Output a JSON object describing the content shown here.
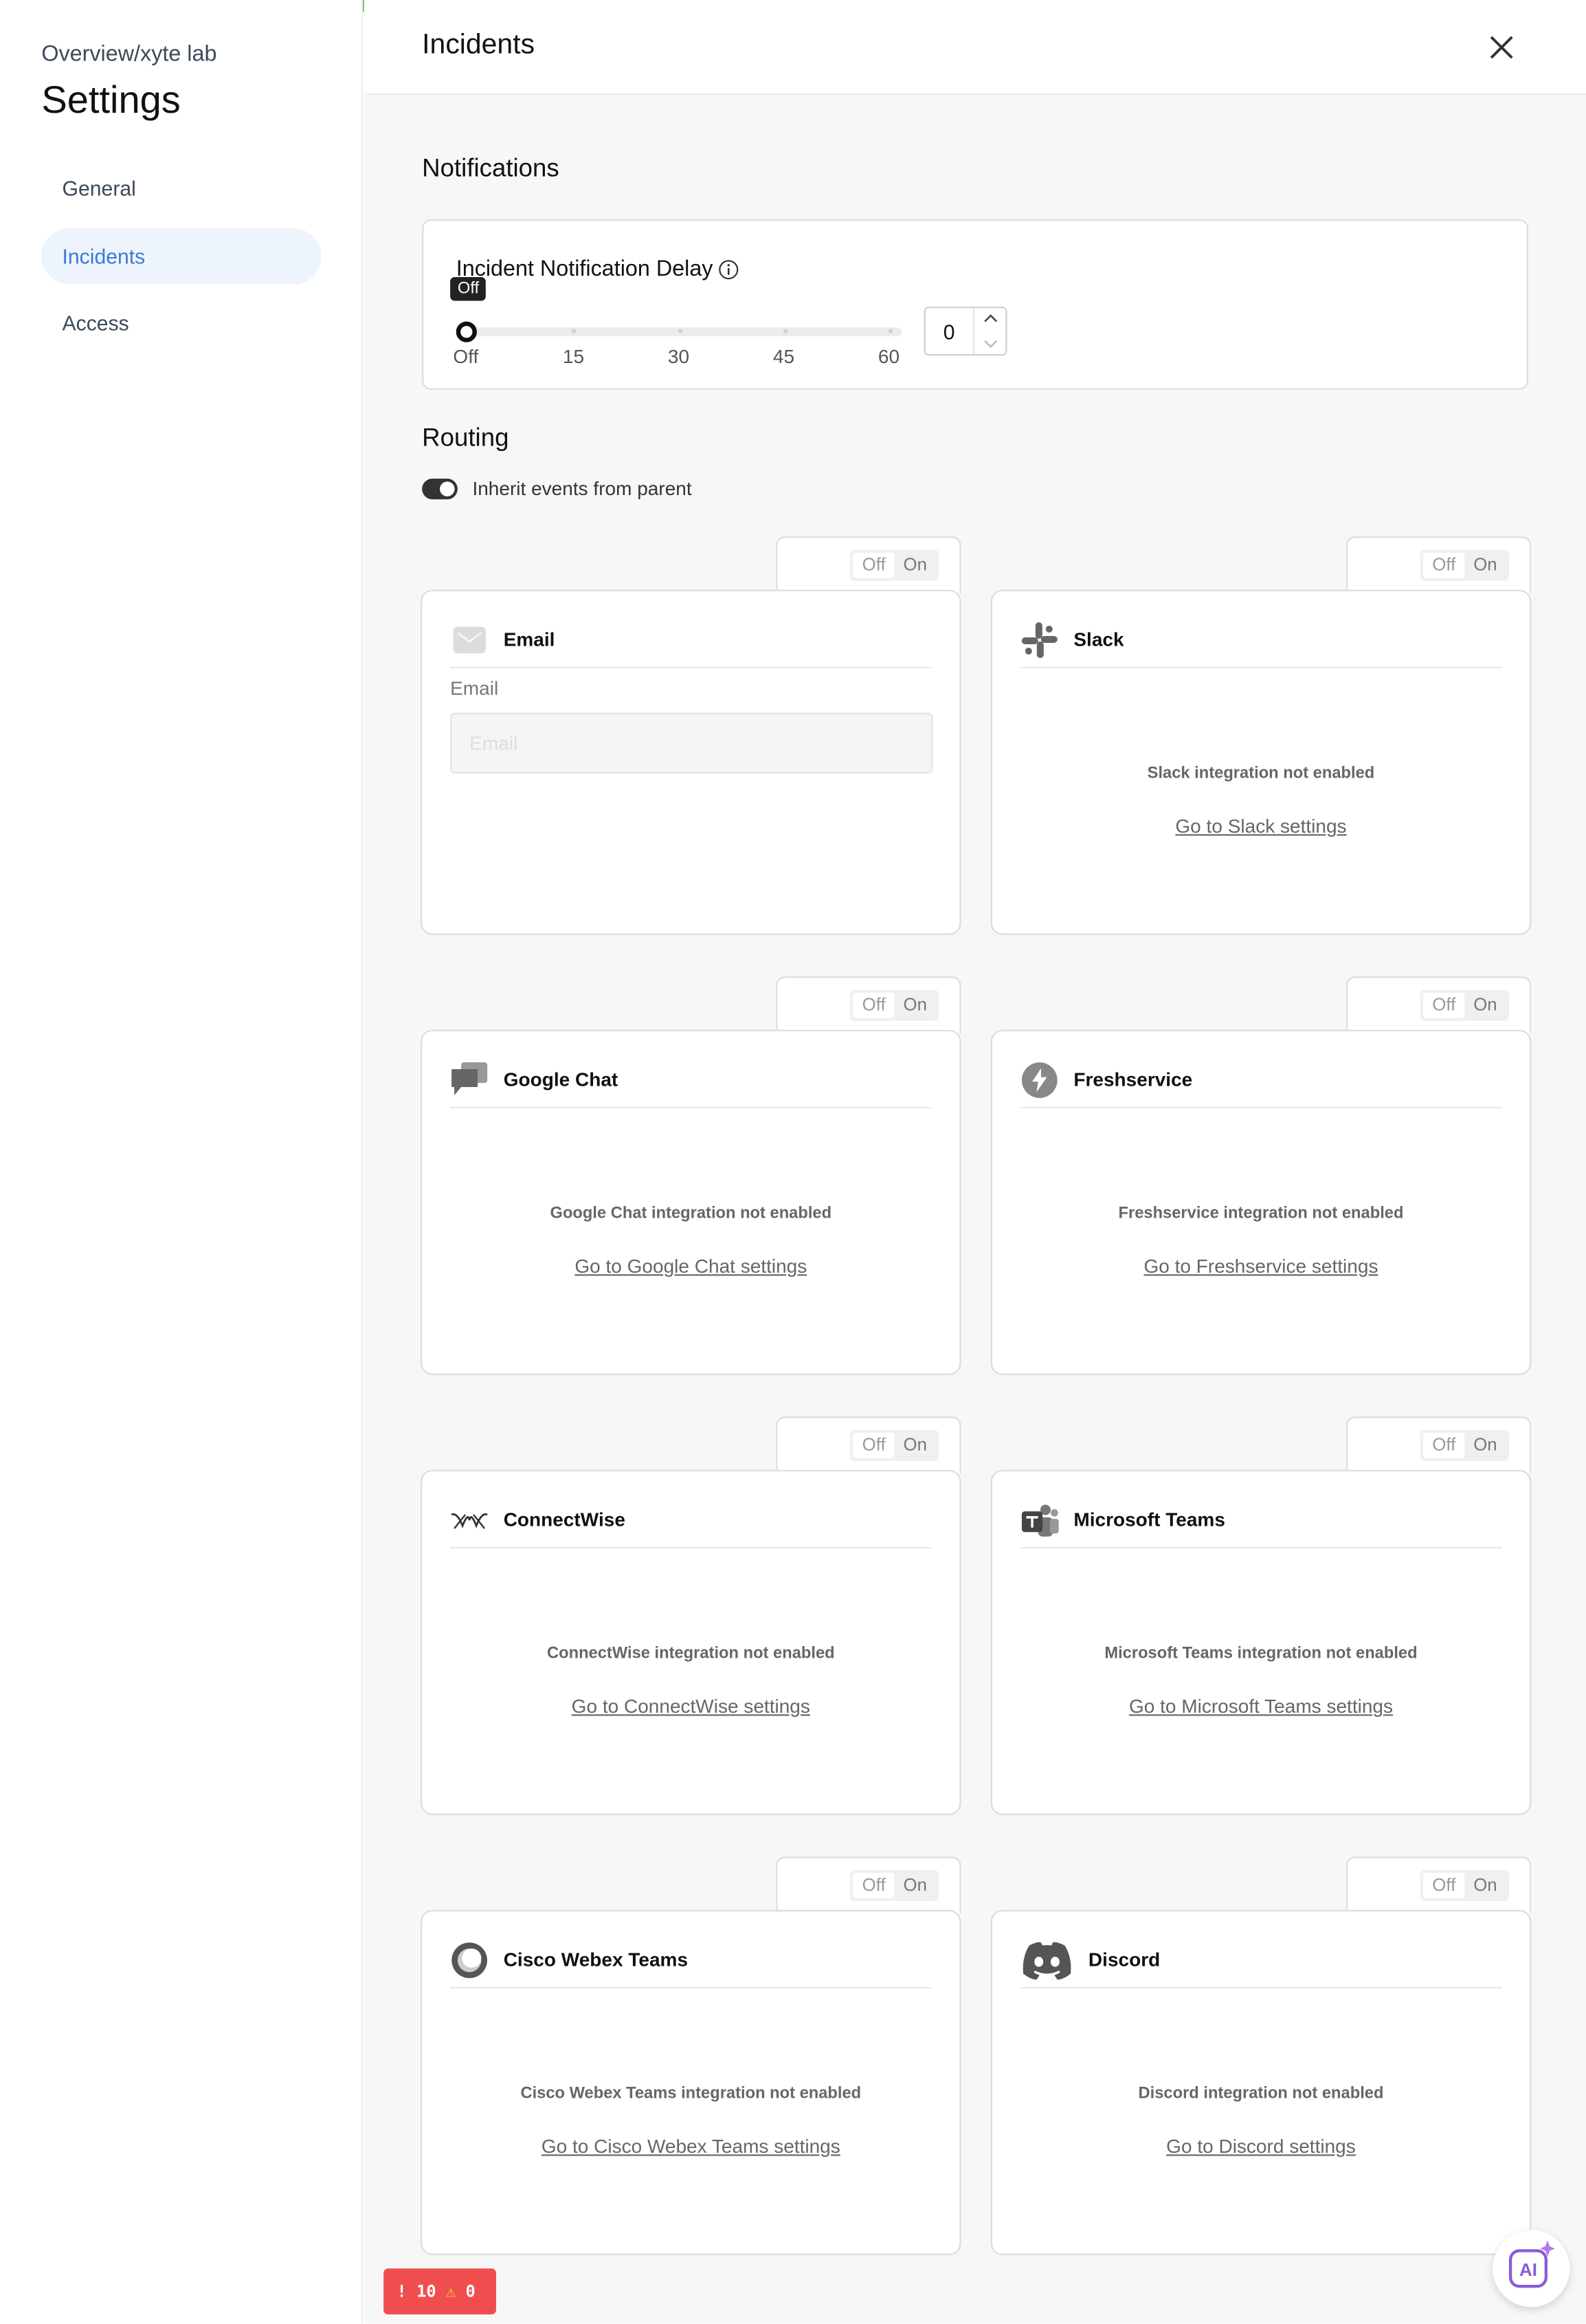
{
  "sidebar": {
    "breadcrumb": "Overview/xyte lab",
    "title": "Settings",
    "items": [
      {
        "label": "General"
      },
      {
        "label": "Incidents"
      },
      {
        "label": "Access"
      }
    ]
  },
  "header": {
    "title": "Incidents"
  },
  "notifications": {
    "title": "Notifications",
    "delay_label": "Incident Notification Delay",
    "tooltip": "Off",
    "slider": {
      "value": 0,
      "ticks": [
        "Off",
        "15",
        "30",
        "45",
        "60"
      ]
    },
    "input_value": "0"
  },
  "routing": {
    "title": "Routing",
    "inherit_label": "Inherit events from parent",
    "inherit_on": true
  },
  "toggle_off": "Off",
  "toggle_on": "On",
  "email": {
    "name": "Email",
    "field_label": "Email",
    "placeholder": "Email"
  },
  "integrations": [
    {
      "name": "Slack",
      "message": "Slack integration not enabled",
      "link": "Go to Slack settings"
    },
    {
      "name": "Google Chat",
      "message": "Google Chat integration not enabled",
      "link": "Go to Google Chat settings"
    },
    {
      "name": "Freshservice",
      "message": "Freshservice integration not enabled",
      "link": "Go to Freshservice settings"
    },
    {
      "name": "ConnectWise",
      "message": "ConnectWise integration not enabled",
      "link": "Go to ConnectWise settings"
    },
    {
      "name": "Microsoft Teams",
      "message": "Microsoft Teams integration not enabled",
      "link": "Go to Microsoft Teams settings"
    },
    {
      "name": "Cisco Webex Teams",
      "message": "Cisco Webex Teams integration not enabled",
      "link": "Go to Cisco Webex Teams settings"
    },
    {
      "name": "Discord",
      "message": "Discord integration not enabled",
      "link": "Go to Discord settings"
    }
  ],
  "error_badge": {
    "errors": "10",
    "warnings": "0"
  },
  "ai_button": {
    "label": "AI"
  },
  "colors": {
    "accent": "#3a7bd5",
    "active_bg": "#eef4fb",
    "error": "#f04e4e"
  }
}
